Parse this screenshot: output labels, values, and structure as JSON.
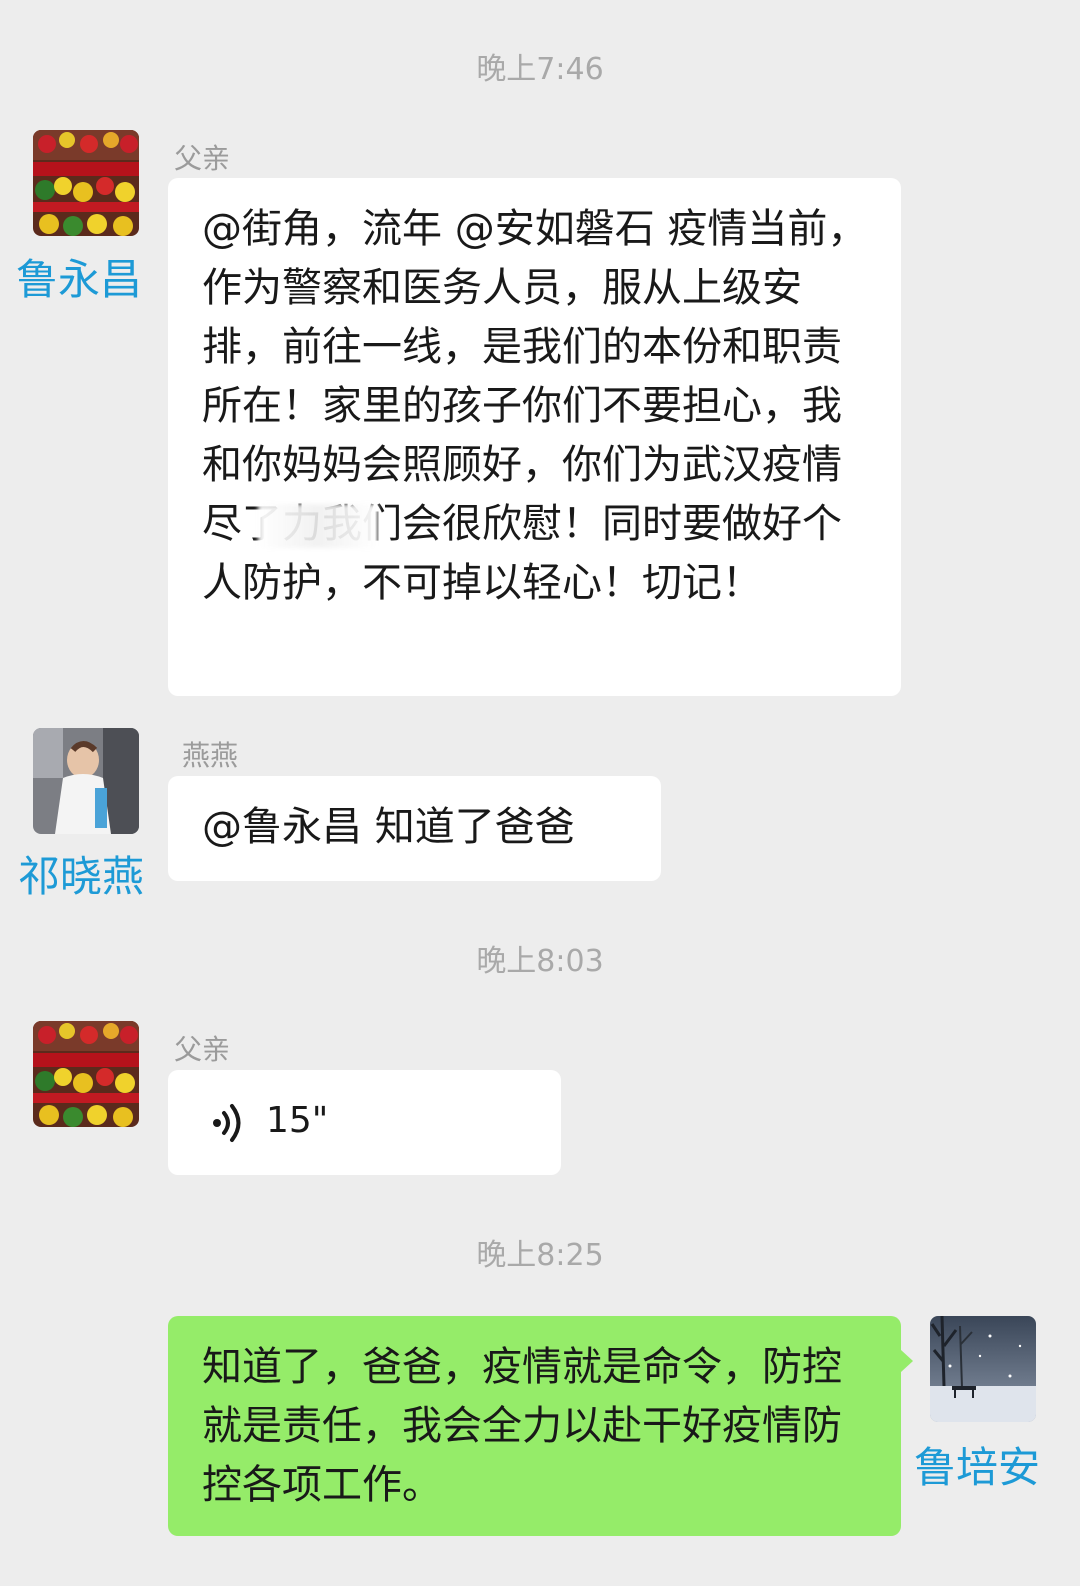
{
  "timestamps": [
    "晚上7:46",
    "晚上8:03",
    "晚上8:25"
  ],
  "messages": [
    {
      "sender": "父亲",
      "avatar_label": "鲁永昌",
      "avatar_icon": "flowers-avatar-icon",
      "text": "@街角，流年 @安如磐石 疫情当前，作为警察和医务人员，服从上级安排，前往一线，是我们的本份和职责所在！家里的孩子你们不要担心，我和你妈妈会照顾好，你们为武汉疫情尽了力我们会很欣慰！同时要做好个人防护，不可掉以轻心！切记！"
    },
    {
      "sender": "燕燕",
      "avatar_label": "祁晓燕",
      "avatar_icon": "child-photo-avatar-icon",
      "text": "@鲁永昌 知道了爸爸"
    },
    {
      "sender": "父亲",
      "avatar_icon": "flowers-avatar-icon",
      "voice_duration": "15\"",
      "voice_icon": "voice-wave-icon"
    },
    {
      "sender": "self",
      "avatar_label": "鲁培安",
      "avatar_icon": "snow-park-avatar-icon",
      "text": "知道了，爸爸，疫情就是命令，防控就是责任，我会全力以赴干好疫情防控各项工作。"
    }
  ],
  "colors": {
    "background": "#ededed",
    "incoming_bubble": "#ffffff",
    "outgoing_bubble": "#95ec69",
    "overlay_name": "#1d9ad6",
    "timestamp": "#a9a9a9"
  }
}
